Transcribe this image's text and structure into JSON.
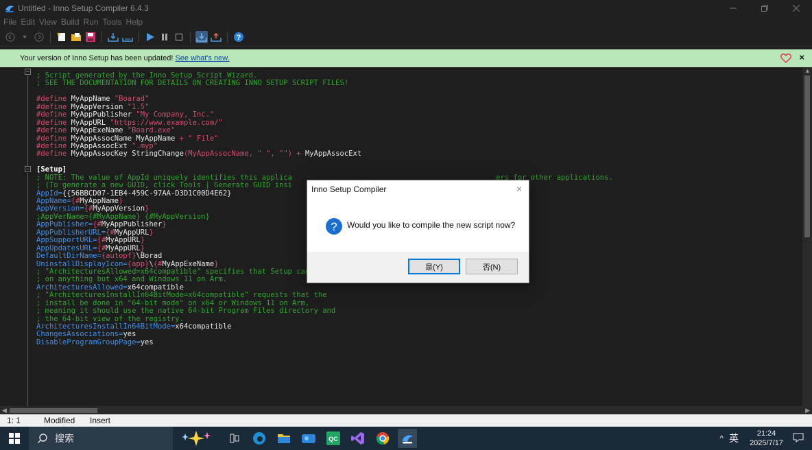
{
  "window": {
    "title": "Untitled - Inno Setup Compiler 6.4.3"
  },
  "menu": [
    "File",
    "Edit",
    "View",
    "Build",
    "Run",
    "Tools",
    "Help"
  ],
  "notification": {
    "text": "Your version of Inno Setup has been updated!",
    "link": "See what's new."
  },
  "editor": {
    "lines": [
      [
        [
          "c-com",
          "; Script generated by the Inno Setup Script Wizard."
        ]
      ],
      [
        [
          "c-com",
          "; SEE THE DOCUMENTATION FOR DETAILS ON CREATING INNO SETUP SCRIPT FILES!"
        ]
      ],
      [],
      [
        [
          "c-kw",
          "#define"
        ],
        [
          "c-txt",
          " MyAppName "
        ],
        [
          "c-str",
          "\"Boarad\""
        ]
      ],
      [
        [
          "c-kw",
          "#define"
        ],
        [
          "c-txt",
          " MyAppVersion "
        ],
        [
          "c-str",
          "\"1.5\""
        ]
      ],
      [
        [
          "c-kw",
          "#define"
        ],
        [
          "c-txt",
          " MyAppPublisher "
        ],
        [
          "c-str",
          "\"My Company, Inc.\""
        ]
      ],
      [
        [
          "c-kw",
          "#define"
        ],
        [
          "c-txt",
          " MyAppURL "
        ],
        [
          "c-str",
          "\"https://www.example.com/\""
        ]
      ],
      [
        [
          "c-kw",
          "#define"
        ],
        [
          "c-txt",
          " MyAppExeName "
        ],
        [
          "c-str",
          "\"Board.exe\""
        ]
      ],
      [
        [
          "c-kw",
          "#define"
        ],
        [
          "c-txt",
          " MyAppAssocName MyAppName "
        ],
        [
          "c-str",
          "+ \" File\""
        ]
      ],
      [
        [
          "c-kw",
          "#define"
        ],
        [
          "c-txt",
          " MyAppAssocExt "
        ],
        [
          "c-str",
          "\".myp\""
        ]
      ],
      [
        [
          "c-kw",
          "#define"
        ],
        [
          "c-txt",
          " MyAppAssocKey StringChange"
        ],
        [
          "c-str",
          "(MyAppAssocName, \" \", \"\") +"
        ],
        [
          "c-txt",
          " MyAppAssocExt"
        ]
      ],
      [],
      [
        [
          "c-sec",
          "[Setup]"
        ]
      ],
      [
        [
          "c-com",
          "; NOTE: The value of AppId uniquely identifies this applica                                               ers for other applications."
        ]
      ],
      [
        [
          "c-com",
          "; (To generate a new GUID, click Tools | Generate GUID insi"
        ]
      ],
      [
        [
          "c-key",
          "AppId="
        ],
        [
          "c-txt",
          "{{56BBCD07-1EB4-459C-97AA-D3D1C00D4E62}"
        ]
      ],
      [
        [
          "c-key",
          "AppName="
        ],
        [
          "c-str",
          "{#"
        ],
        [
          "c-txt",
          "MyAppName"
        ],
        [
          "c-str",
          "}"
        ]
      ],
      [
        [
          "c-key",
          "AppVersion="
        ],
        [
          "c-str",
          "{#"
        ],
        [
          "c-txt",
          "MyAppVersion"
        ],
        [
          "c-str",
          "}"
        ]
      ],
      [
        [
          "c-com",
          ";AppVerName={#MyAppName} {#MyAppVersion}"
        ]
      ],
      [
        [
          "c-key",
          "AppPublisher="
        ],
        [
          "c-str",
          "{#"
        ],
        [
          "c-txt",
          "MyAppPublisher"
        ],
        [
          "c-str",
          "}"
        ]
      ],
      [
        [
          "c-key",
          "AppPublisherURL="
        ],
        [
          "c-str",
          "{#"
        ],
        [
          "c-txt",
          "MyAppURL"
        ],
        [
          "c-str",
          "}"
        ]
      ],
      [
        [
          "c-key",
          "AppSupportURL="
        ],
        [
          "c-str",
          "{#"
        ],
        [
          "c-txt",
          "MyAppURL"
        ],
        [
          "c-str",
          "}"
        ]
      ],
      [
        [
          "c-key",
          "AppUpdatesURL="
        ],
        [
          "c-str",
          "{#"
        ],
        [
          "c-txt",
          "MyAppURL"
        ],
        [
          "c-str",
          "}"
        ]
      ],
      [
        [
          "c-key",
          "DefaultDirName="
        ],
        [
          "c-str",
          "{autopf}"
        ],
        [
          "c-txt",
          "\\Borad"
        ]
      ],
      [
        [
          "c-key",
          "UninstallDisplayIcon="
        ],
        [
          "c-str",
          "{app}"
        ],
        [
          "c-txt",
          "\\"
        ],
        [
          "c-str",
          "{#"
        ],
        [
          "c-txt",
          "MyAppExeName"
        ],
        [
          "c-str",
          "}"
        ]
      ],
      [
        [
          "c-com",
          "; \"ArchitecturesAllowed=x64compatible\" specifies that Setup cannot run"
        ]
      ],
      [
        [
          "c-com",
          "; on anything but x64 and Windows 11 on Arm."
        ]
      ],
      [
        [
          "c-key",
          "ArchitecturesAllowed="
        ],
        [
          "c-txt",
          "x64compatible"
        ]
      ],
      [
        [
          "c-com",
          "; \"ArchitecturesInstallIn64BitMode=x64compatible\" requests that the"
        ]
      ],
      [
        [
          "c-com",
          "; install be done in \"64-bit mode\" on x64 or Windows 11 on Arm,"
        ]
      ],
      [
        [
          "c-com",
          "; meaning it should use the native 64-bit Program Files directory and"
        ]
      ],
      [
        [
          "c-com",
          "; the 64-bit view of the registry."
        ]
      ],
      [
        [
          "c-key",
          "ArchitecturesInstallIn64BitMode="
        ],
        [
          "c-txt",
          "x64compatible"
        ]
      ],
      [
        [
          "c-key",
          "ChangesAssociations="
        ],
        [
          "c-txt",
          "yes"
        ]
      ],
      [
        [
          "c-key",
          "DisableProgramGroupPage="
        ],
        [
          "c-txt",
          "yes"
        ]
      ]
    ]
  },
  "status": {
    "position": "1:  1",
    "modified": "Modified",
    "mode": "Insert"
  },
  "dialog": {
    "title": "Inno Setup Compiler",
    "message": "Would you like to compile the new script now?",
    "yes_label": "是(Y)",
    "no_label": "否(N)"
  },
  "taskbar": {
    "search_label": "搜索",
    "ime": "英",
    "time": "21:24",
    "date": "2025/7/17"
  },
  "colors": {
    "notify_bg": "#b9e7b9",
    "comment": "#2fa52f",
    "directive": "#d14e6c",
    "key": "#3f8ee8",
    "accent": "#0078d7"
  }
}
